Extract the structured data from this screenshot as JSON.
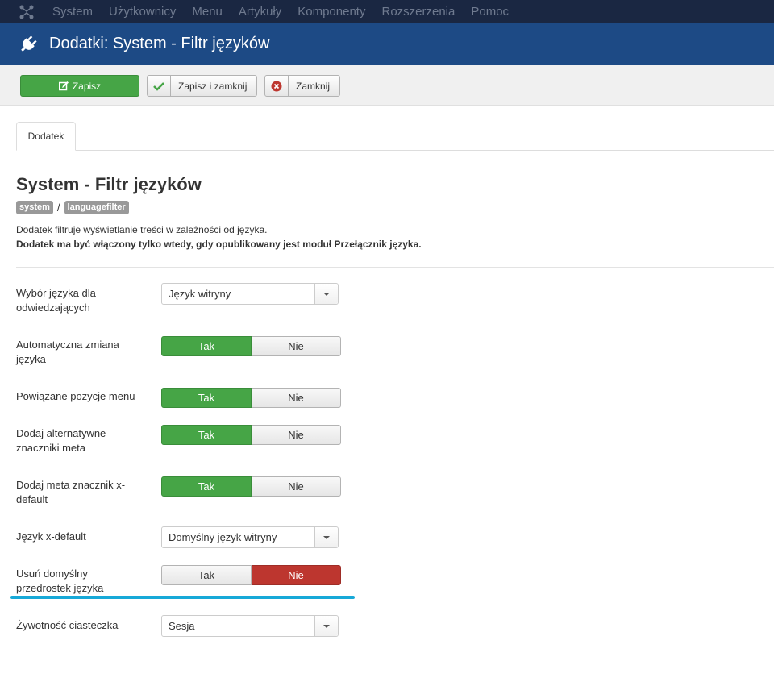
{
  "topbar": {
    "menu": [
      "System",
      "Użytkownicy",
      "Menu",
      "Artykuły",
      "Komponenty",
      "Rozszerzenia",
      "Pomoc"
    ]
  },
  "header": {
    "title": "Dodatki: System - Filtr języków"
  },
  "toolbar": {
    "save_label": "Zapisz",
    "save_close_label": "Zapisz i zamknij",
    "close_label": "Zamknij"
  },
  "tabs": [
    {
      "label": "Dodatek"
    }
  ],
  "plugin": {
    "title": "System - Filtr języków",
    "badges": [
      "system",
      "languagefilter"
    ],
    "separator": "/",
    "description": "Dodatek filtruje wyświetlanie treści w zależności od języka.",
    "note": "Dodatek ma być włączony tylko wtedy, gdy opublikowany jest moduł Przełącznik języka."
  },
  "fields": [
    {
      "label": "Wybór języka dla odwiedzających",
      "type": "select",
      "value": "Język witryny"
    },
    {
      "label": "Automatyczna zmiana języka",
      "type": "toggle",
      "yes": "Tak",
      "no": "Nie",
      "selected": "yes"
    },
    {
      "label": "Powiązane pozycje menu",
      "type": "toggle",
      "yes": "Tak",
      "no": "Nie",
      "selected": "yes"
    },
    {
      "label": "Dodaj alternatywne znaczniki meta",
      "type": "toggle",
      "yes": "Tak",
      "no": "Nie",
      "selected": "yes"
    },
    {
      "label": "Dodaj meta znacznik x-default",
      "type": "toggle",
      "yes": "Tak",
      "no": "Nie",
      "selected": "yes"
    },
    {
      "label": "Język x-default",
      "type": "select",
      "value": "Domyślny język witryny"
    },
    {
      "label": "Usuń domyślny przedrostek języka",
      "type": "toggle",
      "yes": "Tak",
      "no": "Nie",
      "selected": "no"
    },
    {
      "label": "Żywotność ciasteczka",
      "type": "select",
      "value": "Sesja"
    }
  ],
  "colors": {
    "topbar": "#1a2742",
    "header": "#1d4a85",
    "green": "#46a546",
    "red": "#bd362f",
    "highlight": "#17a9d8"
  }
}
